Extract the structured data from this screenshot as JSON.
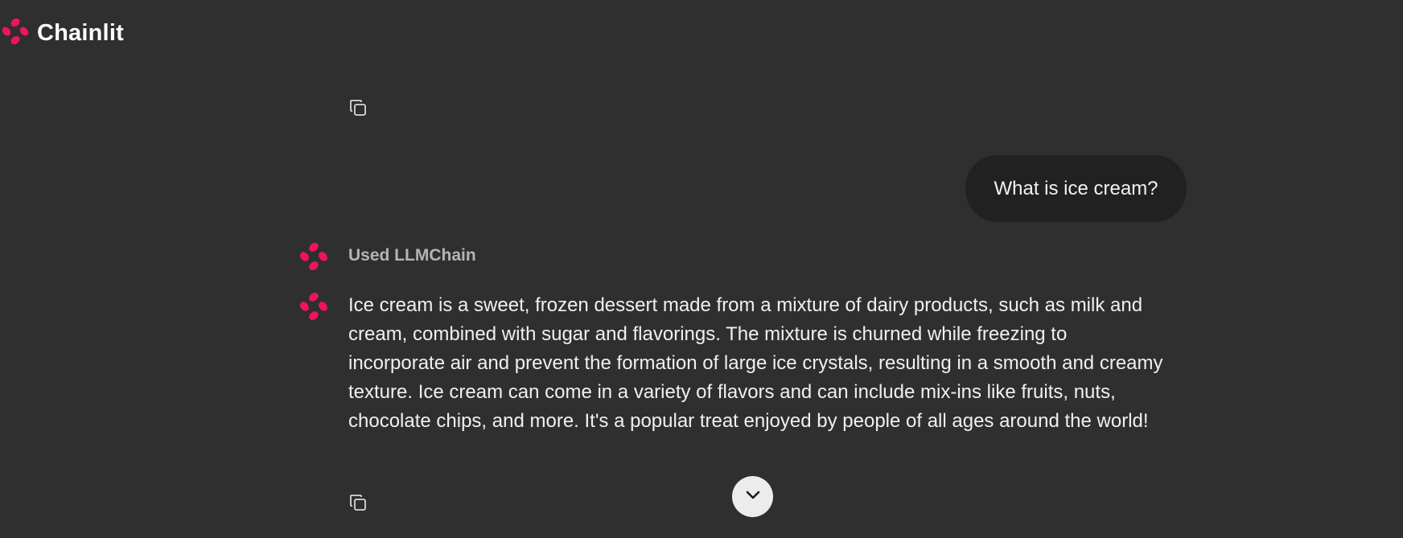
{
  "app": {
    "name": "Chainlit",
    "logo_icon": "chainlit-logo-icon",
    "accent_color": "#f0145a"
  },
  "conversation": {
    "user_message": "What is ice cream?",
    "step_label": "Used LLMChain",
    "assistant_message": "Ice cream is a sweet, frozen dessert made from a mixture of dairy products, such as milk and cream, combined with sugar and flavorings. The mixture is churned while freezing to incorporate air and prevent the formation of large ice crystals, resulting in a smooth and creamy texture. Ice cream can come in a variety of flavors and can include mix-ins like fruits, nuts, chocolate chips, and more. It's a popular treat enjoyed by people of all ages around the world!"
  },
  "icons": {
    "copy": "copy-icon",
    "scroll_down": "chevron-down-icon"
  }
}
